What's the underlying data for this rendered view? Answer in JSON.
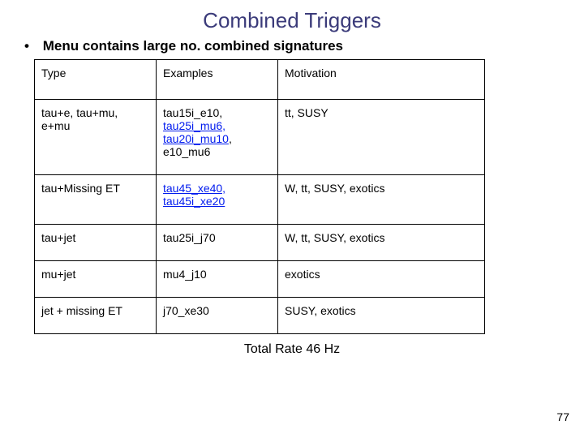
{
  "title": "Combined Triggers",
  "bullet": "Menu contains large no. combined signatures",
  "headers": {
    "type": "Type",
    "examples": "Examples",
    "motivation": "Motivation"
  },
  "rows": [
    {
      "type": "tau+e, tau+mu, e+mu",
      "ex_plain1": "tau15i_e10, ",
      "ex_link1": "tau25i_mu6, tau20i_mu10",
      "ex_plain2": ", e10_mu6",
      "motivation": "tt, SUSY"
    },
    {
      "type": "tau+Missing ET",
      "ex_plain1": "",
      "ex_link1": "tau45_xe40, tau45i_xe20",
      "ex_plain2": "",
      "motivation": "W, tt, SUSY, exotics"
    },
    {
      "type": "tau+jet",
      "ex_plain1": "tau25i_j70",
      "ex_link1": "",
      "ex_plain2": "",
      "motivation": "W, tt, SUSY, exotics"
    },
    {
      "type": "mu+jet",
      "ex_plain1": "mu4_j10",
      "ex_link1": "",
      "ex_plain2": "",
      "motivation": "exotics"
    },
    {
      "type": "jet + missing ET",
      "ex_plain1": "j70_xe30",
      "ex_link1": "",
      "ex_plain2": "",
      "motivation": "SUSY, exotics"
    }
  ],
  "total_rate": "Total Rate 46 Hz",
  "page_number": "77"
}
